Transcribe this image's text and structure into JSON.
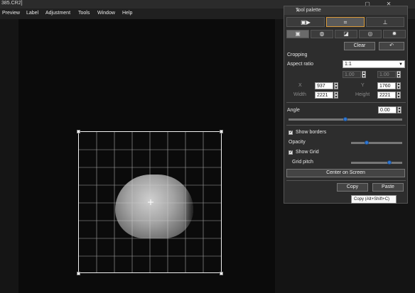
{
  "window": {
    "title": "385.CR2]",
    "minimize": "▢",
    "close": "✕"
  },
  "menu": {
    "items": [
      "Preview",
      "Label",
      "Adjustment",
      "Tools",
      "Window",
      "Help"
    ]
  },
  "palette": {
    "title": "Tool palette",
    "close": "✕",
    "top_tabs": [
      "▣▶",
      "⌗",
      "⊥"
    ],
    "sub_tabs": [
      "▣",
      "◍",
      "◪",
      "◎",
      "✹"
    ],
    "clear": "Clear",
    "undo": "↶",
    "cropping": "Cropping",
    "aspect_ratio_label": "Aspect ratio",
    "aspect_ratio_value": "1:1",
    "ratio_w": "1.00",
    "ratio_h": "1.00",
    "x_label": "X",
    "x_value": "937",
    "y_label": "Y",
    "y_value": "1760",
    "width_label": "Width",
    "width_value": "2221",
    "height_label": "Height",
    "height_value": "2221",
    "angle_label": "Angle",
    "angle_value": "0.00",
    "angle_slider": 0.5,
    "show_borders": "Show borders",
    "opacity": "Opacity",
    "opacity_slider": 0.3,
    "show_grid": "Show Grid",
    "grid_pitch": "Grid pitch",
    "grid_pitch_slider": 0.75,
    "center_on_screen": "Center on Screen",
    "copy": "Copy",
    "paste": "Paste"
  },
  "tooltip": "Copy (Alt+Shift+C)"
}
